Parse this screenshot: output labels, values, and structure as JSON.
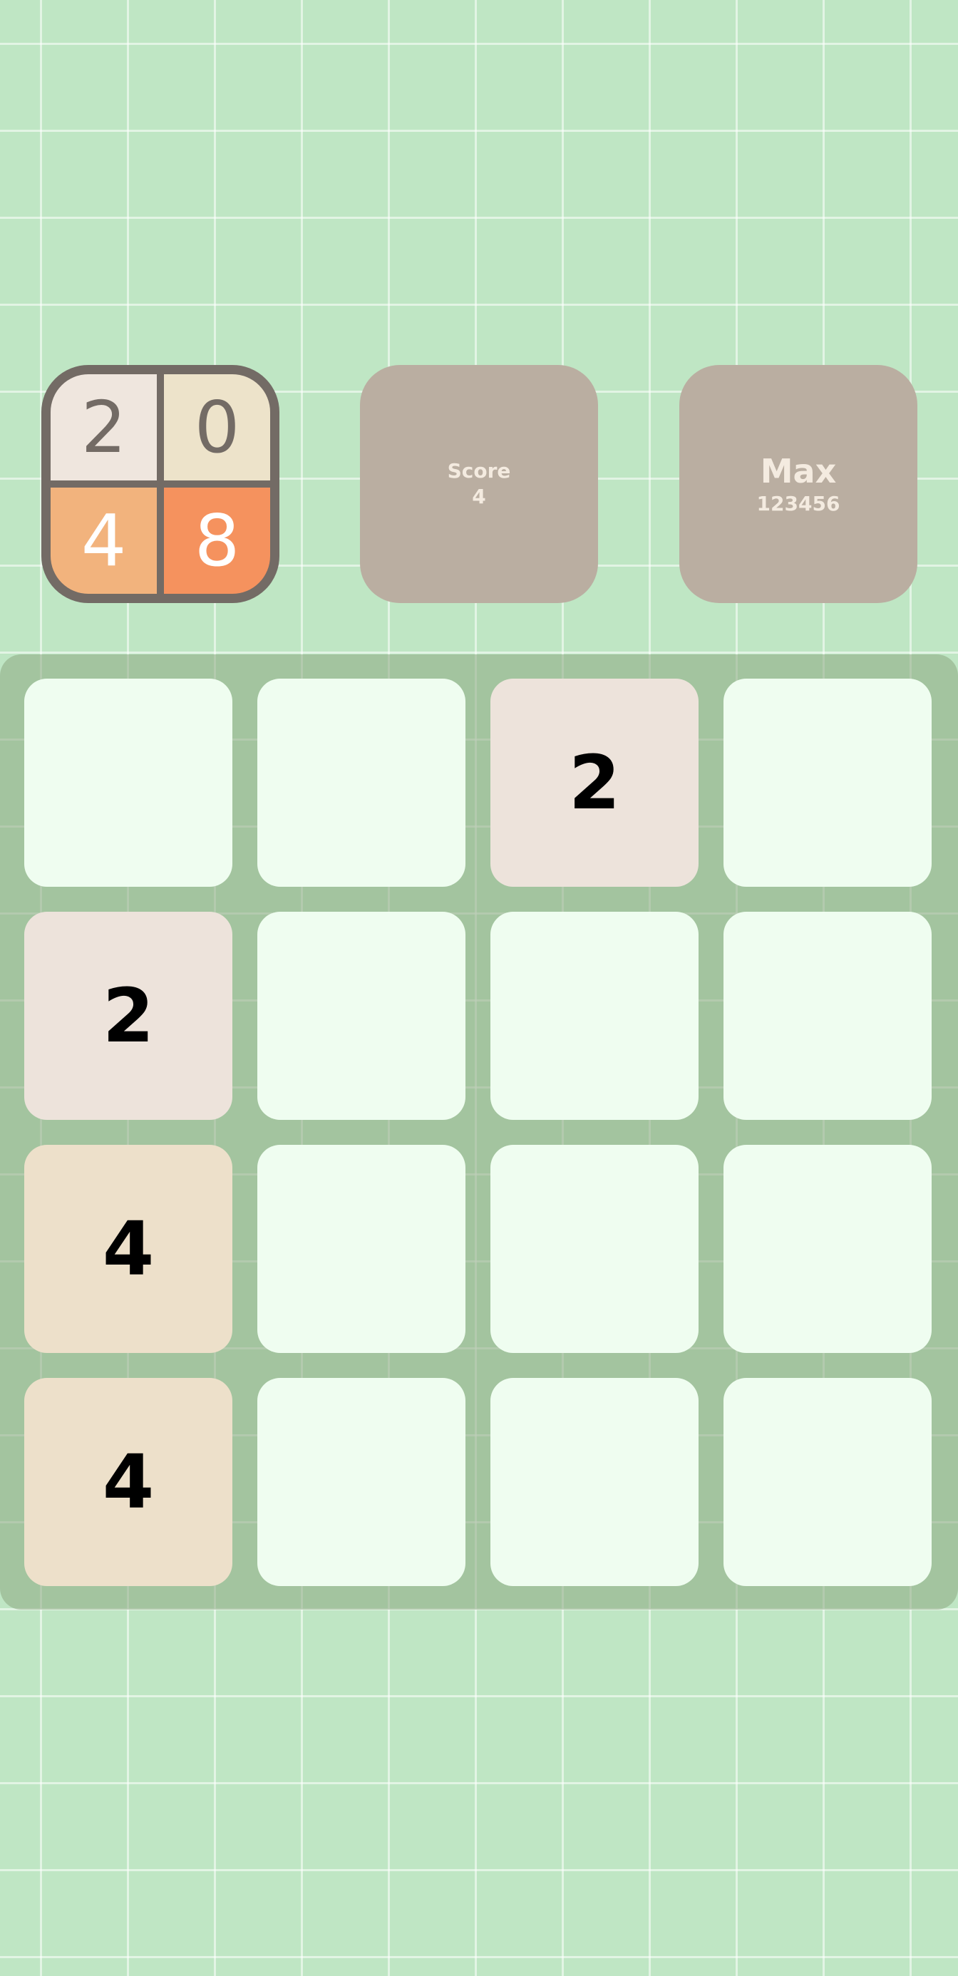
{
  "logo": {
    "digits": [
      "2",
      "0",
      "4",
      "8"
    ]
  },
  "score": {
    "label": "Score",
    "value": "4"
  },
  "max": {
    "label": "Max",
    "value": "123456"
  },
  "board": {
    "rows": 4,
    "cols": 4,
    "tiles": [
      [
        "",
        "",
        "2",
        ""
      ],
      [
        "2",
        "",
        "",
        ""
      ],
      [
        "4",
        "",
        "",
        ""
      ],
      [
        "4",
        "",
        "",
        ""
      ]
    ]
  },
  "colors": {
    "background": "#bfe6c4",
    "empty_tile": "#effdf0",
    "tile_2": "#ede3db",
    "tile_4": "#ede0ca",
    "stat_box": "#baaea1",
    "logo_frame": "#736b65",
    "logo_4": "#f2b37d",
    "logo_8": "#f5925e"
  }
}
